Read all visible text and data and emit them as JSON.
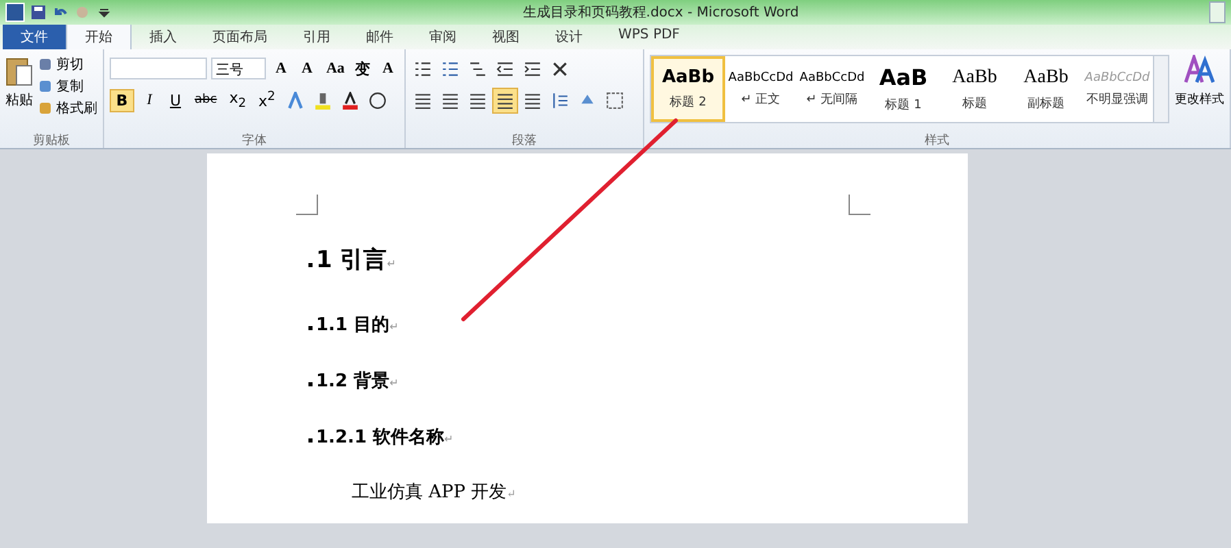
{
  "window": {
    "title": "生成目录和页码教程.docx - Microsoft Word"
  },
  "tabs": [
    {
      "label": "文件",
      "kind": "file",
      "selected": false
    },
    {
      "label": "开始",
      "kind": "tab",
      "selected": true
    },
    {
      "label": "插入",
      "kind": "tab",
      "selected": false
    },
    {
      "label": "页面布局",
      "kind": "tab",
      "selected": false
    },
    {
      "label": "引用",
      "kind": "tab",
      "selected": false
    },
    {
      "label": "邮件",
      "kind": "tab",
      "selected": false
    },
    {
      "label": "审阅",
      "kind": "tab",
      "selected": false
    },
    {
      "label": "视图",
      "kind": "tab",
      "selected": false
    },
    {
      "label": "设计",
      "kind": "tab",
      "selected": false
    },
    {
      "label": "WPS PDF",
      "kind": "tab",
      "selected": false
    }
  ],
  "clipboard": {
    "label": "剪贴板",
    "paste": "粘贴",
    "items": [
      "剪切",
      "复制",
      "格式刷"
    ]
  },
  "font": {
    "label": "字体",
    "size": "三号",
    "row1": [
      "A",
      "A",
      "Aa",
      "变",
      "A"
    ],
    "row2": [
      {
        "label": "B",
        "selected": true
      },
      {
        "label": "I",
        "selected": false
      },
      {
        "label": "U",
        "selected": false
      },
      {
        "label": "abc",
        "selected": false
      },
      {
        "label": "x$_{2}$",
        "selected": false
      },
      {
        "label": "x$^{2}$",
        "selected": false
      }
    ]
  },
  "paragraph": {
    "label": "段落",
    "alignments": [
      {
        "selected": false
      },
      {
        "selected": false
      },
      {
        "selected": false
      },
      {
        "selected": true
      },
      {
        "selected": false
      }
    ]
  },
  "styles": {
    "label": "样式",
    "items": [
      {
        "sample": "AaBb",
        "name": "标题 2",
        "kind": "heading2",
        "selected": true
      },
      {
        "sample": "AaBbCcDd",
        "name": "↵ 正文",
        "kind": "normal",
        "selected": false
      },
      {
        "sample": "AaBbCcDd",
        "name": "↵ 无间隔",
        "kind": "normal",
        "selected": false
      },
      {
        "sample": "AaB",
        "name": "标题 1",
        "kind": "heading1",
        "selected": false
      },
      {
        "sample": "AaBb",
        "name": "标题",
        "kind": "title",
        "selected": false
      },
      {
        "sample": "AaBb",
        "name": "副标题",
        "kind": "title",
        "selected": false
      },
      {
        "sample": "AaBbCcDd",
        "name": "不明显强调",
        "kind": "emphasis",
        "selected": false
      }
    ],
    "change_styles": "更改样式"
  },
  "document": {
    "paragraphs": [
      {
        "kind": "h1",
        "text": "1 引言",
        "mark": "↵"
      },
      {
        "kind": "h2",
        "text": "1.1 目的",
        "mark": "↵"
      },
      {
        "kind": "h2",
        "text": "1.2 背景",
        "mark": "↵"
      },
      {
        "kind": "h3",
        "text": "1.2.1  软件名称",
        "mark": "↵"
      },
      {
        "kind": "body",
        "text": "工业仿真 APP 开发",
        "mark": "↵"
      }
    ]
  }
}
